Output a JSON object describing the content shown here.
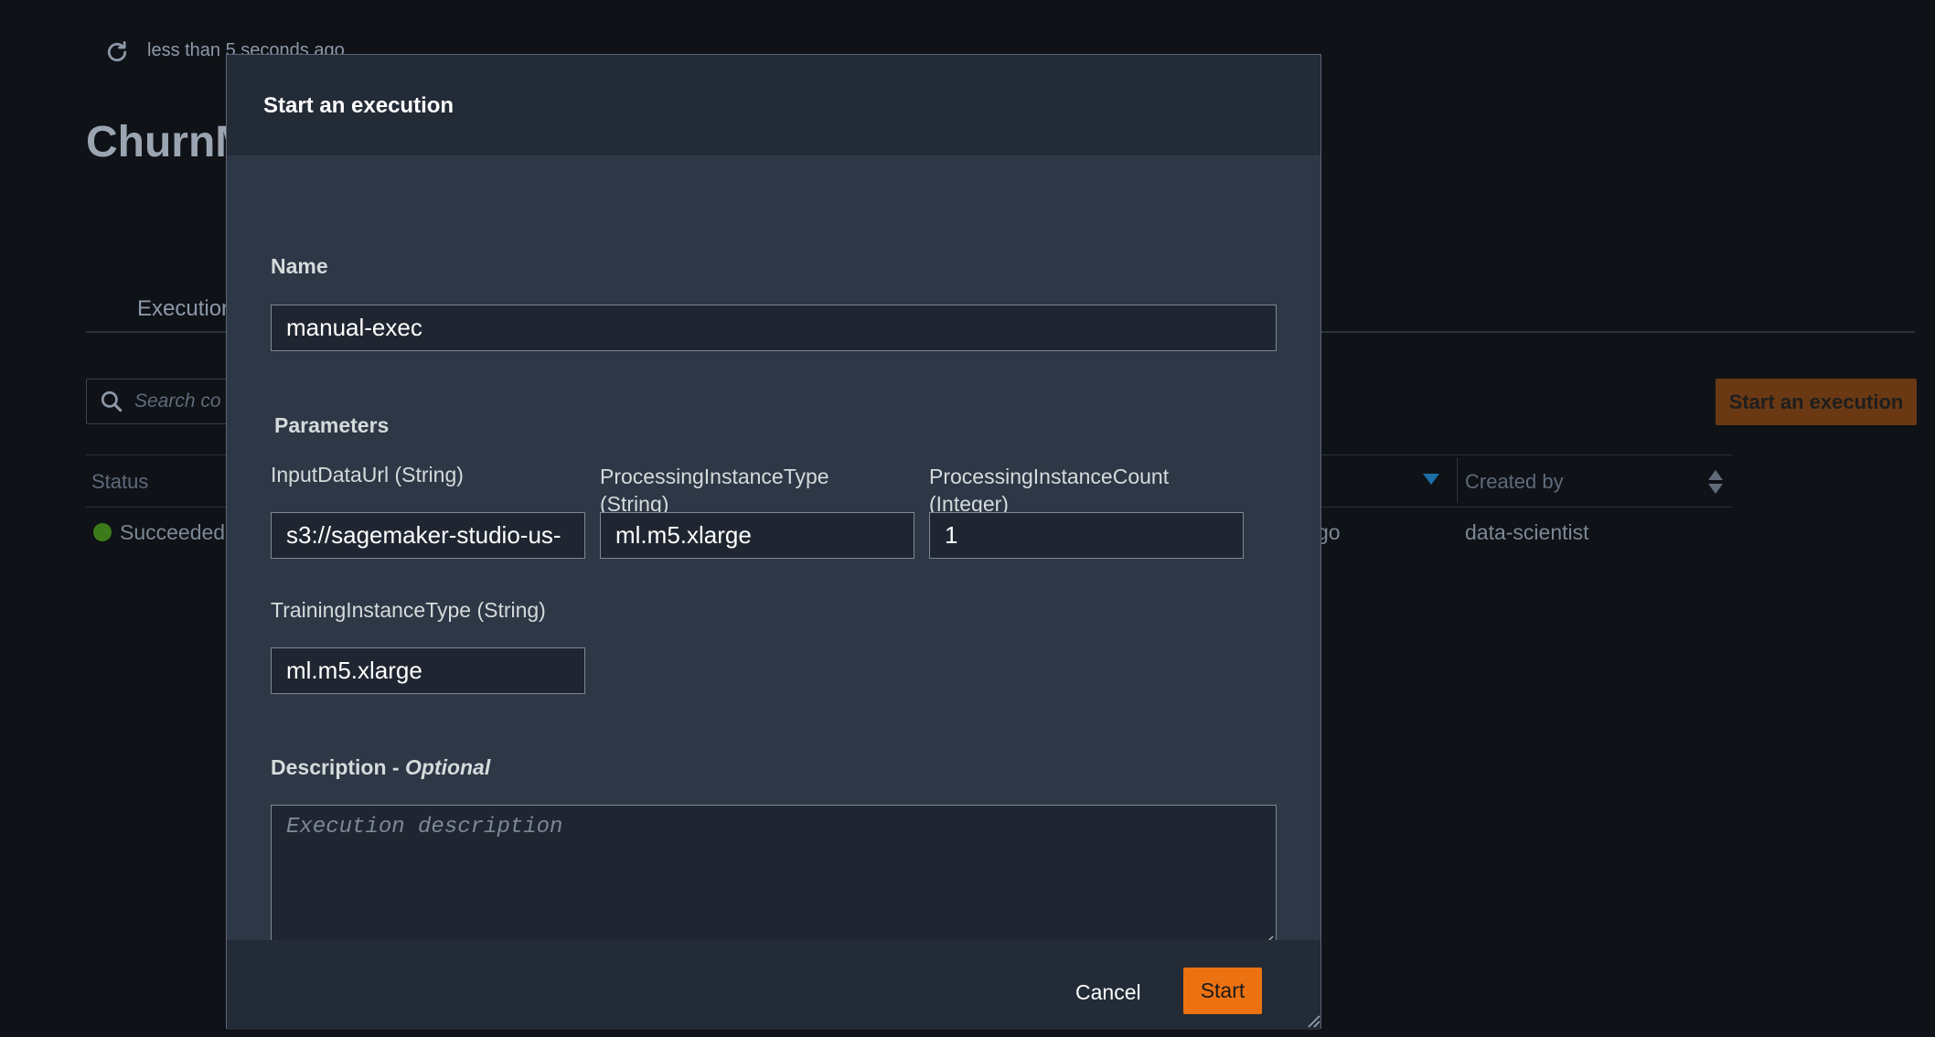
{
  "background": {
    "refresh_text": "less than 5 seconds ago",
    "page_title": "ChurnM",
    "tab_label": "Execution",
    "search_placeholder": "Search co",
    "start_button_label": "Start an execution",
    "columns": {
      "status": "Status",
      "created_by": "Created by"
    },
    "row": {
      "status": "Succeeded",
      "time_suffix": "go",
      "created_by": "data-scientist"
    },
    "colors": {
      "success": "#3d7a1a",
      "sort_active": "#1b6fa5"
    }
  },
  "modal": {
    "title": "Start an execution",
    "name_label": "Name",
    "name_value": "manual-exec",
    "parameters_heading": "Parameters",
    "parameters": [
      {
        "label_line1": "InputDataUrl (String)",
        "label_line2": "",
        "value": "s3://sagemaker-studio-us-"
      },
      {
        "label_line1": "ProcessingInstanceType",
        "label_line2": "(String)",
        "value": "ml.m5.xlarge"
      },
      {
        "label_line1": "ProcessingInstanceCount",
        "label_line2": "(Integer)",
        "value": "1"
      },
      {
        "label_line1": "TrainingInstanceType (String)",
        "label_line2": "",
        "value": "ml.m5.xlarge"
      }
    ],
    "description_label": "Description - ",
    "description_optional": "Optional",
    "description_placeholder": "Execution description",
    "cancel_label": "Cancel",
    "start_label": "Start",
    "colors": {
      "primary": "#ec7211",
      "header_bg": "#232b37",
      "body_bg": "#2e3746"
    }
  }
}
